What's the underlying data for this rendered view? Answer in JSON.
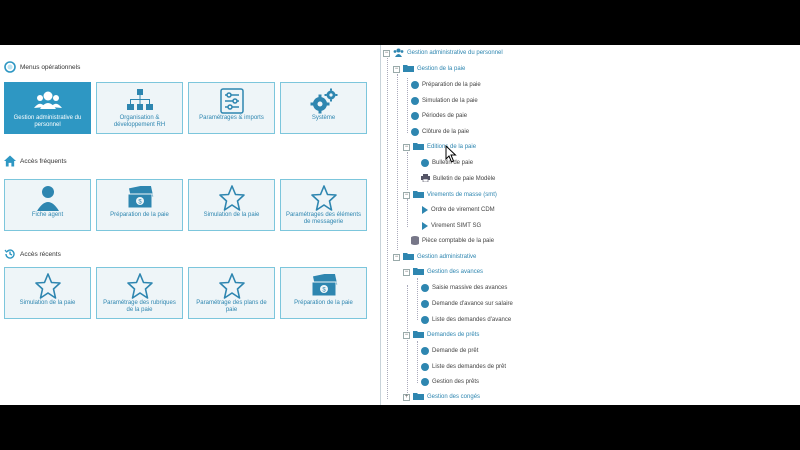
{
  "sections": {
    "ops": "Menus opérationnels",
    "freq": "Accès fréquents",
    "recent": "Accès récents"
  },
  "ops_tiles": [
    {
      "label": "Gestion administrative du personnel",
      "icon": "users-icon"
    },
    {
      "label": "Organisation & développement RH",
      "icon": "org-chart-icon"
    },
    {
      "label": "Paramétrages & imports",
      "icon": "settings-sliders-icon"
    },
    {
      "label": "Système",
      "icon": "gears-icon"
    }
  ],
  "freq_tiles": [
    {
      "label": "Fiche agent",
      "icon": "person-icon"
    },
    {
      "label": "Préparation de la paie",
      "icon": "banknote-icon"
    },
    {
      "label": "Simulation de la paie",
      "icon": "star-icon"
    },
    {
      "label": "Paramétrages des éléments de messagerie",
      "icon": "star-icon"
    }
  ],
  "recent_tiles": [
    {
      "label": "Simulation de la paie",
      "icon": "star-icon"
    },
    {
      "label": "Paramétrage des rubriques de la paie",
      "icon": "star-icon"
    },
    {
      "label": "Paramétrage des plans de paie",
      "icon": "star-icon"
    },
    {
      "label": "Préparation de la paie",
      "icon": "banknote-icon"
    }
  ],
  "tree": {
    "root": "Gestion administrative du personnel",
    "paie": "Gestion de la paie",
    "paie_items": [
      "Préparation de la paie",
      "Simulation de la paie",
      "Périodes de paie",
      "Clôture de la paie"
    ],
    "edition": "Editions de la paie",
    "edition_items": [
      "Bulletin de paie",
      "Bulletin de paie Modèle"
    ],
    "virement": "Virements de masse (smt)",
    "virement_items": [
      "Ordre de virement CDM",
      "Virement SIMT SG"
    ],
    "piece": "Pièce comptable de la paie",
    "admin": "Gestion administrative",
    "avances": "Gestion des avances",
    "avances_items": [
      "Saisie massive des avances",
      "Demande d'avance sur salaire",
      "Liste des demandes d'avance"
    ],
    "prets": "Demandes de prêts",
    "prets_items": [
      "Demande de prêt",
      "Liste des demandes de prêt",
      "Gestion des prêts"
    ],
    "conges": "Gestion des congés"
  },
  "colors": {
    "accent": "#2e97c3",
    "tile_bg": "#eef5f8",
    "tile_border": "#7cc6dc"
  }
}
